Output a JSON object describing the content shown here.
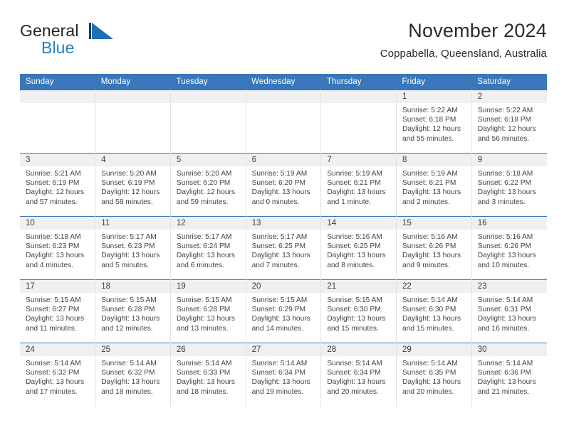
{
  "brand": {
    "name_part1": "General",
    "name_part2": "Blue",
    "mark": "blue-triangle-logo"
  },
  "header": {
    "title": "November 2024",
    "subtitle": "Coppabella, Queensland, Australia"
  },
  "colors": {
    "header_blue": "#3a77ba",
    "brand_blue": "#1d83c9",
    "daynum_strip": "#f0f0f0",
    "text": "#444444"
  },
  "calendar": {
    "weekdays": [
      "Sunday",
      "Monday",
      "Tuesday",
      "Wednesday",
      "Thursday",
      "Friday",
      "Saturday"
    ],
    "weeks": [
      [
        {
          "day": "",
          "empty": true
        },
        {
          "day": "",
          "empty": true
        },
        {
          "day": "",
          "empty": true
        },
        {
          "day": "",
          "empty": true
        },
        {
          "day": "",
          "empty": true
        },
        {
          "day": "1",
          "sunrise": "Sunrise: 5:22 AM",
          "sunset": "Sunset: 6:18 PM",
          "daylight": "Daylight: 12 hours and 55 minutes."
        },
        {
          "day": "2",
          "sunrise": "Sunrise: 5:22 AM",
          "sunset": "Sunset: 6:18 PM",
          "daylight": "Daylight: 12 hours and 56 minutes."
        }
      ],
      [
        {
          "day": "3",
          "sunrise": "Sunrise: 5:21 AM",
          "sunset": "Sunset: 6:19 PM",
          "daylight": "Daylight: 12 hours and 57 minutes."
        },
        {
          "day": "4",
          "sunrise": "Sunrise: 5:20 AM",
          "sunset": "Sunset: 6:19 PM",
          "daylight": "Daylight: 12 hours and 58 minutes."
        },
        {
          "day": "5",
          "sunrise": "Sunrise: 5:20 AM",
          "sunset": "Sunset: 6:20 PM",
          "daylight": "Daylight: 12 hours and 59 minutes."
        },
        {
          "day": "6",
          "sunrise": "Sunrise: 5:19 AM",
          "sunset": "Sunset: 6:20 PM",
          "daylight": "Daylight: 13 hours and 0 minutes."
        },
        {
          "day": "7",
          "sunrise": "Sunrise: 5:19 AM",
          "sunset": "Sunset: 6:21 PM",
          "daylight": "Daylight: 13 hours and 1 minute."
        },
        {
          "day": "8",
          "sunrise": "Sunrise: 5:19 AM",
          "sunset": "Sunset: 6:21 PM",
          "daylight": "Daylight: 13 hours and 2 minutes."
        },
        {
          "day": "9",
          "sunrise": "Sunrise: 5:18 AM",
          "sunset": "Sunset: 6:22 PM",
          "daylight": "Daylight: 13 hours and 3 minutes."
        }
      ],
      [
        {
          "day": "10",
          "sunrise": "Sunrise: 5:18 AM",
          "sunset": "Sunset: 6:23 PM",
          "daylight": "Daylight: 13 hours and 4 minutes."
        },
        {
          "day": "11",
          "sunrise": "Sunrise: 5:17 AM",
          "sunset": "Sunset: 6:23 PM",
          "daylight": "Daylight: 13 hours and 5 minutes."
        },
        {
          "day": "12",
          "sunrise": "Sunrise: 5:17 AM",
          "sunset": "Sunset: 6:24 PM",
          "daylight": "Daylight: 13 hours and 6 minutes."
        },
        {
          "day": "13",
          "sunrise": "Sunrise: 5:17 AM",
          "sunset": "Sunset: 6:25 PM",
          "daylight": "Daylight: 13 hours and 7 minutes."
        },
        {
          "day": "14",
          "sunrise": "Sunrise: 5:16 AM",
          "sunset": "Sunset: 6:25 PM",
          "daylight": "Daylight: 13 hours and 8 minutes."
        },
        {
          "day": "15",
          "sunrise": "Sunrise: 5:16 AM",
          "sunset": "Sunset: 6:26 PM",
          "daylight": "Daylight: 13 hours and 9 minutes."
        },
        {
          "day": "16",
          "sunrise": "Sunrise: 5:16 AM",
          "sunset": "Sunset: 6:26 PM",
          "daylight": "Daylight: 13 hours and 10 minutes."
        }
      ],
      [
        {
          "day": "17",
          "sunrise": "Sunrise: 5:15 AM",
          "sunset": "Sunset: 6:27 PM",
          "daylight": "Daylight: 13 hours and 11 minutes."
        },
        {
          "day": "18",
          "sunrise": "Sunrise: 5:15 AM",
          "sunset": "Sunset: 6:28 PM",
          "daylight": "Daylight: 13 hours and 12 minutes."
        },
        {
          "day": "19",
          "sunrise": "Sunrise: 5:15 AM",
          "sunset": "Sunset: 6:28 PM",
          "daylight": "Daylight: 13 hours and 13 minutes."
        },
        {
          "day": "20",
          "sunrise": "Sunrise: 5:15 AM",
          "sunset": "Sunset: 6:29 PM",
          "daylight": "Daylight: 13 hours and 14 minutes."
        },
        {
          "day": "21",
          "sunrise": "Sunrise: 5:15 AM",
          "sunset": "Sunset: 6:30 PM",
          "daylight": "Daylight: 13 hours and 15 minutes."
        },
        {
          "day": "22",
          "sunrise": "Sunrise: 5:14 AM",
          "sunset": "Sunset: 6:30 PM",
          "daylight": "Daylight: 13 hours and 15 minutes."
        },
        {
          "day": "23",
          "sunrise": "Sunrise: 5:14 AM",
          "sunset": "Sunset: 6:31 PM",
          "daylight": "Daylight: 13 hours and 16 minutes."
        }
      ],
      [
        {
          "day": "24",
          "sunrise": "Sunrise: 5:14 AM",
          "sunset": "Sunset: 6:32 PM",
          "daylight": "Daylight: 13 hours and 17 minutes."
        },
        {
          "day": "25",
          "sunrise": "Sunrise: 5:14 AM",
          "sunset": "Sunset: 6:32 PM",
          "daylight": "Daylight: 13 hours and 18 minutes."
        },
        {
          "day": "26",
          "sunrise": "Sunrise: 5:14 AM",
          "sunset": "Sunset: 6:33 PM",
          "daylight": "Daylight: 13 hours and 18 minutes."
        },
        {
          "day": "27",
          "sunrise": "Sunrise: 5:14 AM",
          "sunset": "Sunset: 6:34 PM",
          "daylight": "Daylight: 13 hours and 19 minutes."
        },
        {
          "day": "28",
          "sunrise": "Sunrise: 5:14 AM",
          "sunset": "Sunset: 6:34 PM",
          "daylight": "Daylight: 13 hours and 20 minutes."
        },
        {
          "day": "29",
          "sunrise": "Sunrise: 5:14 AM",
          "sunset": "Sunset: 6:35 PM",
          "daylight": "Daylight: 13 hours and 20 minutes."
        },
        {
          "day": "30",
          "sunrise": "Sunrise: 5:14 AM",
          "sunset": "Sunset: 6:36 PM",
          "daylight": "Daylight: 13 hours and 21 minutes."
        }
      ]
    ]
  }
}
